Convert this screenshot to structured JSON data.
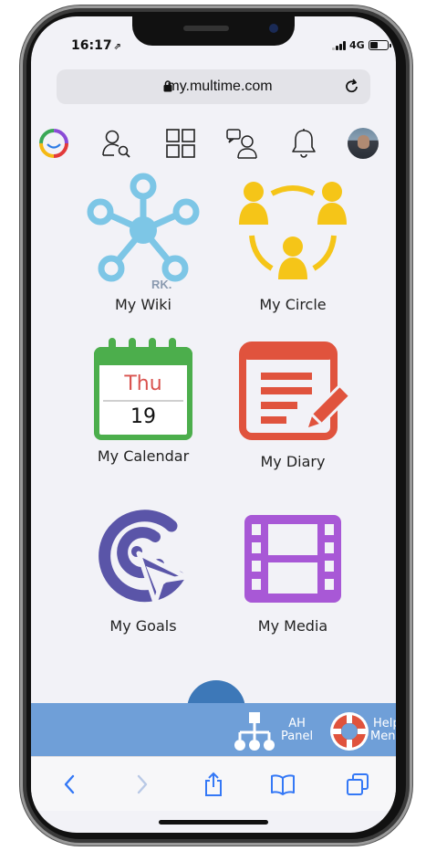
{
  "status_bar": {
    "time": "16:17",
    "location_arrow": "⇗",
    "network": "4G",
    "battery_level": 0.45
  },
  "browser": {
    "url": "my.multime.com",
    "lock_icon": "lock-icon",
    "reload_icon": "reload-icon"
  },
  "toolbar": {
    "logo_icon": "multime-ring-logo-icon",
    "items": [
      "search-people-icon",
      "apps-grid-icon",
      "chat-people-icon",
      "bell-icon",
      "profile-avatar"
    ]
  },
  "tiles": [
    {
      "label": "My Wiki",
      "icon": "wiki-network-icon",
      "watermark": "RK."
    },
    {
      "label": "My Circle",
      "icon": "circle-people-icon"
    },
    {
      "label": "My Calendar",
      "icon": "calendar-icon",
      "calendar_day": "Thu",
      "calendar_date": "19"
    },
    {
      "label": "My Diary",
      "icon": "diary-icon"
    },
    {
      "label": "My Goals",
      "icon": "goals-target-icon"
    },
    {
      "label": "My Media",
      "icon": "film-strip-icon"
    }
  ],
  "bottom_panel": {
    "ah_panel_line1": "AH",
    "ah_panel_line2": "Panel",
    "help_line1": "Help",
    "help_line2": "Menu"
  },
  "safari_toolbar": [
    "back-icon",
    "forward-icon",
    "share-icon",
    "bookmarks-icon",
    "tabs-icon"
  ],
  "colors": {
    "wiki": "#7dc6e6",
    "circle": "#f5c518",
    "calendar_green": "#4cae4c",
    "calendar_red": "#d9534f",
    "diary": "#e0533d",
    "goals": "#5a55a8",
    "media": "#a858d6",
    "panel_blue": "#6f9fd8"
  }
}
